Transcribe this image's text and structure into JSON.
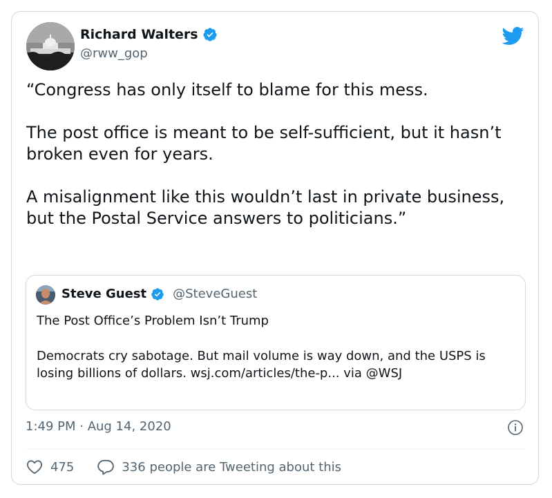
{
  "author": {
    "name": "Richard Walters",
    "handle": "@rww_gop",
    "verified": true,
    "avatar_icon": "capitol-photo-avatar"
  },
  "brand": {
    "icon": "twitter-bird-icon",
    "color": "#1d9bf0"
  },
  "tweet": {
    "paragraphs": [
      "“Congress has only itself to blame for this mess.",
      "The post office is meant to be self-sufficient, but it hasn’t broken even for years.",
      "A misalignment like this wouldn’t last in private business, but the Postal Service answers to politicians.”"
    ],
    "timestamp": "1:49 PM · Aug 14, 2020"
  },
  "quoted": {
    "name": "Steve Guest",
    "handle": "@SteveGuest",
    "verified": true,
    "title": "The Post Office’s Problem Isn’t Trump",
    "body": "Democrats cry sabotage. But mail volume is way down, and the USPS is losing billions of dollars. wsj.com/articles/the-p... via @WSJ"
  },
  "actions": {
    "likes": "475",
    "conversation": "336 people are Tweeting about this"
  },
  "colors": {
    "text": "#0f1419",
    "secondary": "#536471",
    "border": "#cfd9de",
    "verified": "#1d9bf0"
  }
}
